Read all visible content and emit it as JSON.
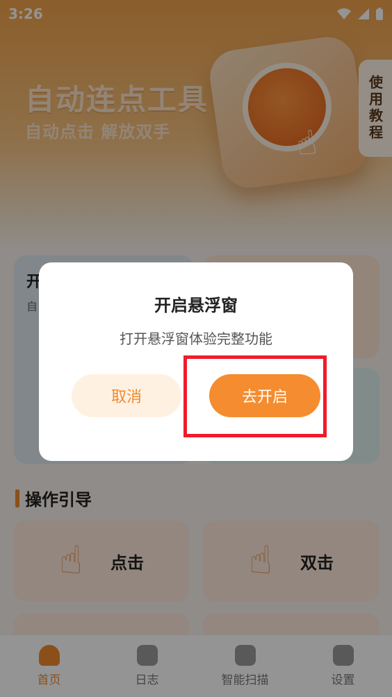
{
  "status_bar": {
    "time": "3:26"
  },
  "hero": {
    "title": "自动连点工具",
    "subtitle": "自动点击 解放双手",
    "tutorial_label": "使用教程"
  },
  "feature_cards": {
    "card1_title": "开",
    "card1_subtitle": "自"
  },
  "section": {
    "title": "操作引导"
  },
  "guides": [
    {
      "label": "点击"
    },
    {
      "label": "双击"
    }
  ],
  "bottom_nav": [
    {
      "label": "首页",
      "active": true
    },
    {
      "label": "日志",
      "active": false
    },
    {
      "label": "智能扫描",
      "active": false
    },
    {
      "label": "设置",
      "active": false
    }
  ],
  "dialog": {
    "title": "开启悬浮窗",
    "message": "打开悬浮窗体验完整功能",
    "cancel_label": "取消",
    "confirm_label": "去开启"
  },
  "colors": {
    "accent": "#f58c2f",
    "highlight": "#ee1c2c"
  }
}
